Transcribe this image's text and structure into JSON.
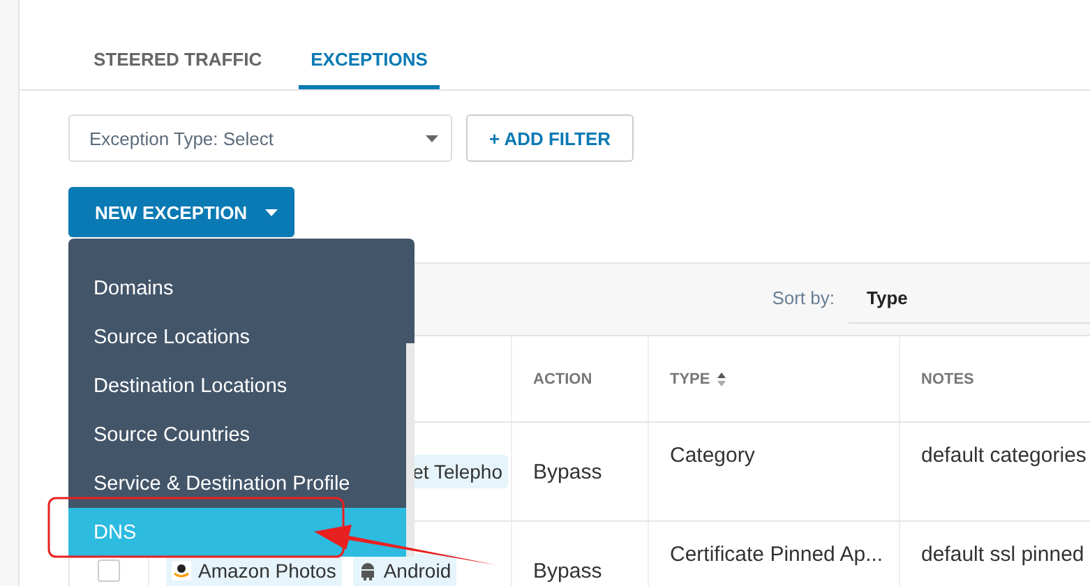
{
  "tabs": [
    {
      "label": "STEERED TRAFFIC",
      "selected": false
    },
    {
      "label": "EXCEPTIONS",
      "selected": true
    }
  ],
  "filter": {
    "select": "Exception Type: Select",
    "add_button": "+ ADD FILTER"
  },
  "new_exception": {
    "label": "NEW EXCEPTION",
    "expanded": true,
    "menu": [
      {
        "label": "Domains",
        "selected": false
      },
      {
        "label": "Source Locations",
        "selected": false
      },
      {
        "label": "Destination Locations",
        "selected": false
      },
      {
        "label": "Source Countries",
        "selected": false
      },
      {
        "label": "Service & Destination Profile",
        "selected": false
      },
      {
        "label": "DNS",
        "selected": true
      }
    ]
  },
  "panel": {
    "sort_label": "Sort by:",
    "sort_value": "Type"
  },
  "table": {
    "columns": [
      {
        "label": "ACTION",
        "sortable": false
      },
      {
        "label": "TYPE",
        "sortable": true
      },
      {
        "label": "NOTES",
        "sortable": false
      }
    ],
    "rows": [
      {
        "tags": [
          {
            "kind": "category",
            "label": "et Telepho"
          }
        ],
        "action": "Bypass",
        "type": "Category",
        "notes": "default categories"
      },
      {
        "checked": false,
        "tags": [
          {
            "kind": "app",
            "label": "Amazon Photos"
          },
          {
            "kind": "os",
            "label": "Android"
          }
        ],
        "action": "Bypass",
        "type": "Certificate Pinned Ap...",
        "notes": "default ssl pinned"
      }
    ]
  }
}
